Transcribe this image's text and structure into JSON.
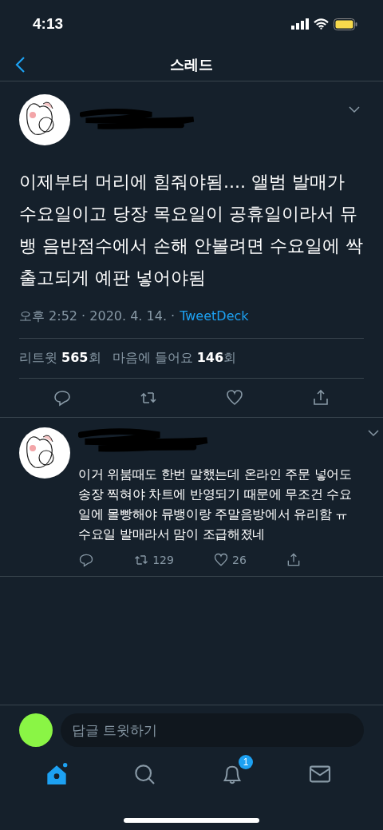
{
  "status_bar": {
    "time": "4:13"
  },
  "header": {
    "title": "스레드"
  },
  "tweet": {
    "text": "이제부터 머리에 힘줘야됨.... 앨범 발매가 수요일이고 당장 목요일이 공휴일이라서 뮤뱅 음반점수에서 손해 안볼려면 수요일에 싹 출고되게 예판 넣어야됨",
    "timestamp": "오후 2:52 · 2020. 4. 14. ·",
    "source": "TweetDeck",
    "stats": [
      "리트윗 **565**회",
      "마음에 들어요 **146**회"
    ]
  },
  "replies": [
    {
      "text": "이거 위붐때도 한번 말했는데 온라인 주문 넣어도 송장 찍혀야 차트에 반영되기 때문에 무조건 수요일에 몰빵해야 뮤뱅이랑 주말음방에서 유리함 ㅠ 수요일 발매라서 맘이 조급해졌네",
      "retweets": "129",
      "likes": "26"
    }
  ],
  "reply_bar": {
    "placeholder": "답글 트윗하기"
  },
  "tab_bar": {
    "items": [
      {
        "kind": "home",
        "selected": true
      },
      {
        "kind": "search",
        "selected": false
      },
      {
        "kind": "notifications",
        "selected": false,
        "badge": "1"
      },
      {
        "kind": "messages",
        "selected": false
      }
    ]
  }
}
